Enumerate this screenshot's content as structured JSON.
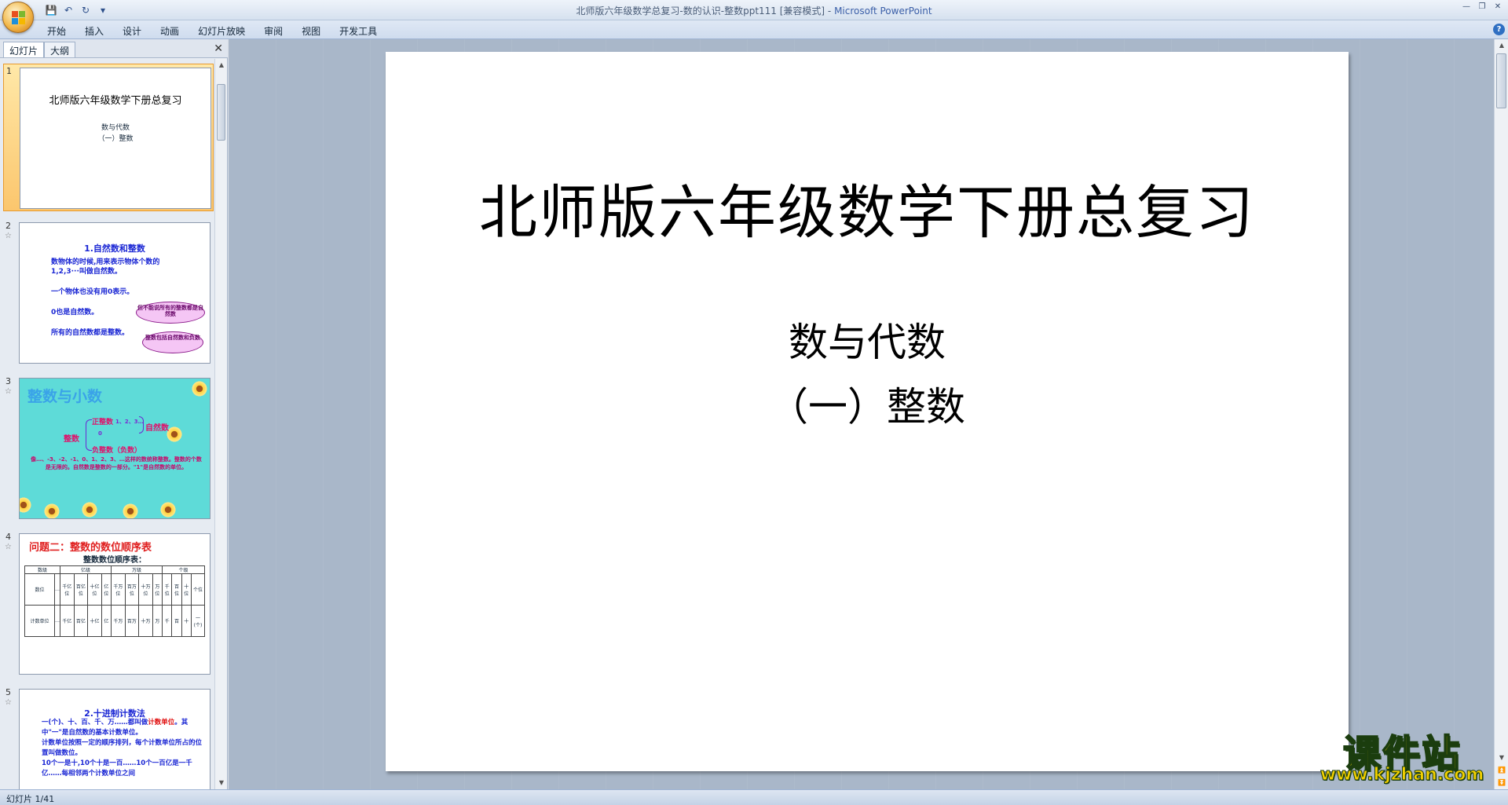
{
  "window": {
    "title": "北师版六年级数学总复习-数的认识-整数ppt111 [兼容模式] - ",
    "app_name": "Microsoft PowerPoint"
  },
  "qat": {
    "save_icon": "💾",
    "undo_icon": "↶",
    "redo_icon": "↻",
    "customize_icon": "▾"
  },
  "window_controls": {
    "minimize": "—",
    "restore": "❐",
    "close": "✕"
  },
  "ribbon": {
    "tabs": [
      "开始",
      "插入",
      "设计",
      "动画",
      "幻灯片放映",
      "审阅",
      "视图",
      "开发工具"
    ],
    "help": "?"
  },
  "left_pane": {
    "tabs": [
      "幻灯片",
      "大纲"
    ],
    "close": "✕",
    "slides": [
      {
        "num": "1",
        "title": "北师版六年级数学下册总复习",
        "sub1": "数与代数",
        "sub2": "（一）整数"
      },
      {
        "num": "2",
        "title": "1.自然数和整数",
        "line1": "数物体的时候,用来表示物体个数的",
        "line2": "1,2,3···叫做自然数。",
        "line3": "一个物体也没有用0表示。",
        "line4": "0也是自然数。",
        "line5": "所有的自然数都是整数。",
        "bubble1": "但不能说所有的整数都是自然数",
        "bubble2": "整数包括自然数和负数"
      },
      {
        "num": "3",
        "head": "整数与小数",
        "zhengshu": "整数",
        "zhengzhengshu": "正整数",
        "seq": "1、2、3…",
        "zero": "0",
        "ziranshu": "自然数",
        "fuzhengshu": "负整数（负数）",
        "note": "像…、-3、-2、-1、0、1、2、3、…这样的数统称整数。整数的个数是无限的。自然数是整数的一部分。\"1\"是自然数的单位。"
      },
      {
        "num": "4",
        "title": "问题二：整数的数位顺序表",
        "sub": "整数数位顺序表：",
        "row_header": [
          "数级",
          "亿级",
          "万级",
          "个级"
        ],
        "row1_label": "数位",
        "row1": [
          "…",
          "千亿位",
          "百亿位",
          "十亿位",
          "亿位",
          "千万位",
          "百万位",
          "十万位",
          "万位",
          "千位",
          "百位",
          "十位",
          "个位"
        ],
        "row2_label": "计数单位",
        "row2": [
          "…",
          "千亿",
          "百亿",
          "十亿",
          "亿",
          "千万",
          "百万",
          "十万",
          "万",
          "千",
          "百",
          "十",
          "一(个)"
        ]
      },
      {
        "num": "5",
        "title": "2.十进制计数法",
        "p1a": "一(个)、十、百、千、万……都叫做",
        "p1b": "计数单位",
        "p1c": "。其中\"一\"是自然数的基本计数单位。",
        "p2": "计数单位按照一定的顺序排列，每个计数单位所占的位置叫做数位。",
        "p3": "10个一是十,10个十是一百……10个一百亿是一千亿……每相邻两个计数单位之间"
      }
    ]
  },
  "main_slide": {
    "title": "北师版六年级数学下册总复习",
    "sub1": "数与代数",
    "sub2": "（一）整数"
  },
  "status": {
    "slide_info": "幻灯片 1/41"
  },
  "watermark": {
    "cn": "课件站",
    "url": "www.kjzhan.com"
  }
}
